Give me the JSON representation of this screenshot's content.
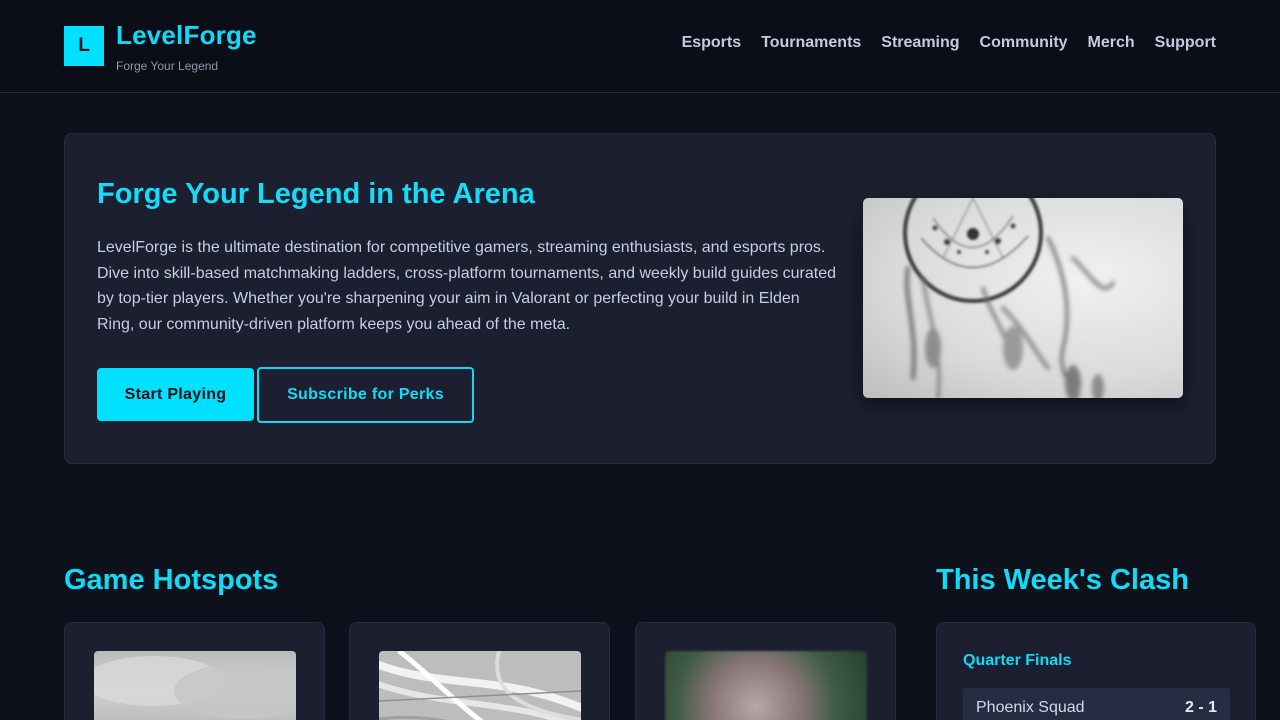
{
  "brand": {
    "logo_letter": "L",
    "name": "LevelForge",
    "tagline": "Forge Your Legend"
  },
  "nav": {
    "items": [
      "Esports",
      "Tournaments",
      "Streaming",
      "Community",
      "Merch",
      "Support"
    ]
  },
  "hero": {
    "title": "Forge Your Legend in the Arena",
    "description": "LevelForge is the ultimate destination for competitive gamers, streaming enthusiasts, and esports pros. Dive into skill-based matchmaking ladders, cross-platform tournaments, and weekly build guides curated by top-tier players. Whether you're sharpening your aim in Valorant or perfecting your build in Elden Ring, our community-driven platform keeps you ahead of the meta.",
    "primary_button": "Start Playing",
    "secondary_button": "Subscribe for Perks",
    "image_icon": "dreamcatcher-photo"
  },
  "hotspots": {
    "title": "Game Hotspots",
    "cards": [
      {
        "image_icon": "cloudy-sky-photo"
      },
      {
        "image_icon": "highway-interchange-photo"
      },
      {
        "image_icon": "blurred-leaves-photo"
      }
    ]
  },
  "clash": {
    "title": "This Week's Clash",
    "stage": "Quarter Finals",
    "matches": [
      {
        "team": "Phoenix Squad",
        "score": "2 - 1"
      }
    ]
  },
  "colors": {
    "accent": "#00e1ff",
    "background": "#0d111b",
    "panel": "#1b1f2f"
  }
}
